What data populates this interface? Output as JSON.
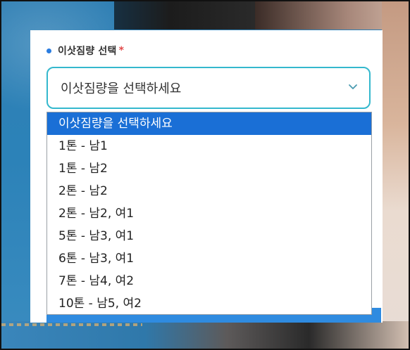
{
  "field": {
    "label": "이삿짐량 선택",
    "required_mark": "*",
    "selected_value": "이삿짐량을 선택하세요"
  },
  "dropdown": {
    "options": [
      "이삿짐량을 선택하세요",
      "1톤 - 남1",
      "1톤 - 남2",
      "2톤 - 남2",
      "2톤 - 남2, 여1",
      "5톤 - 남3, 여1",
      "6톤 - 남3, 여1",
      "7톤 - 남4, 여2",
      "10톤 - 남5, 여2"
    ],
    "highlighted_index": 0
  },
  "colors": {
    "accent": "#34b8cd",
    "highlight": "#1a6fd6",
    "required": "#e24a4a",
    "dot": "#2b7de0"
  },
  "icons": {
    "select_arrow": "chevron-down-icon",
    "label_marker": "bullet-dot-icon"
  }
}
